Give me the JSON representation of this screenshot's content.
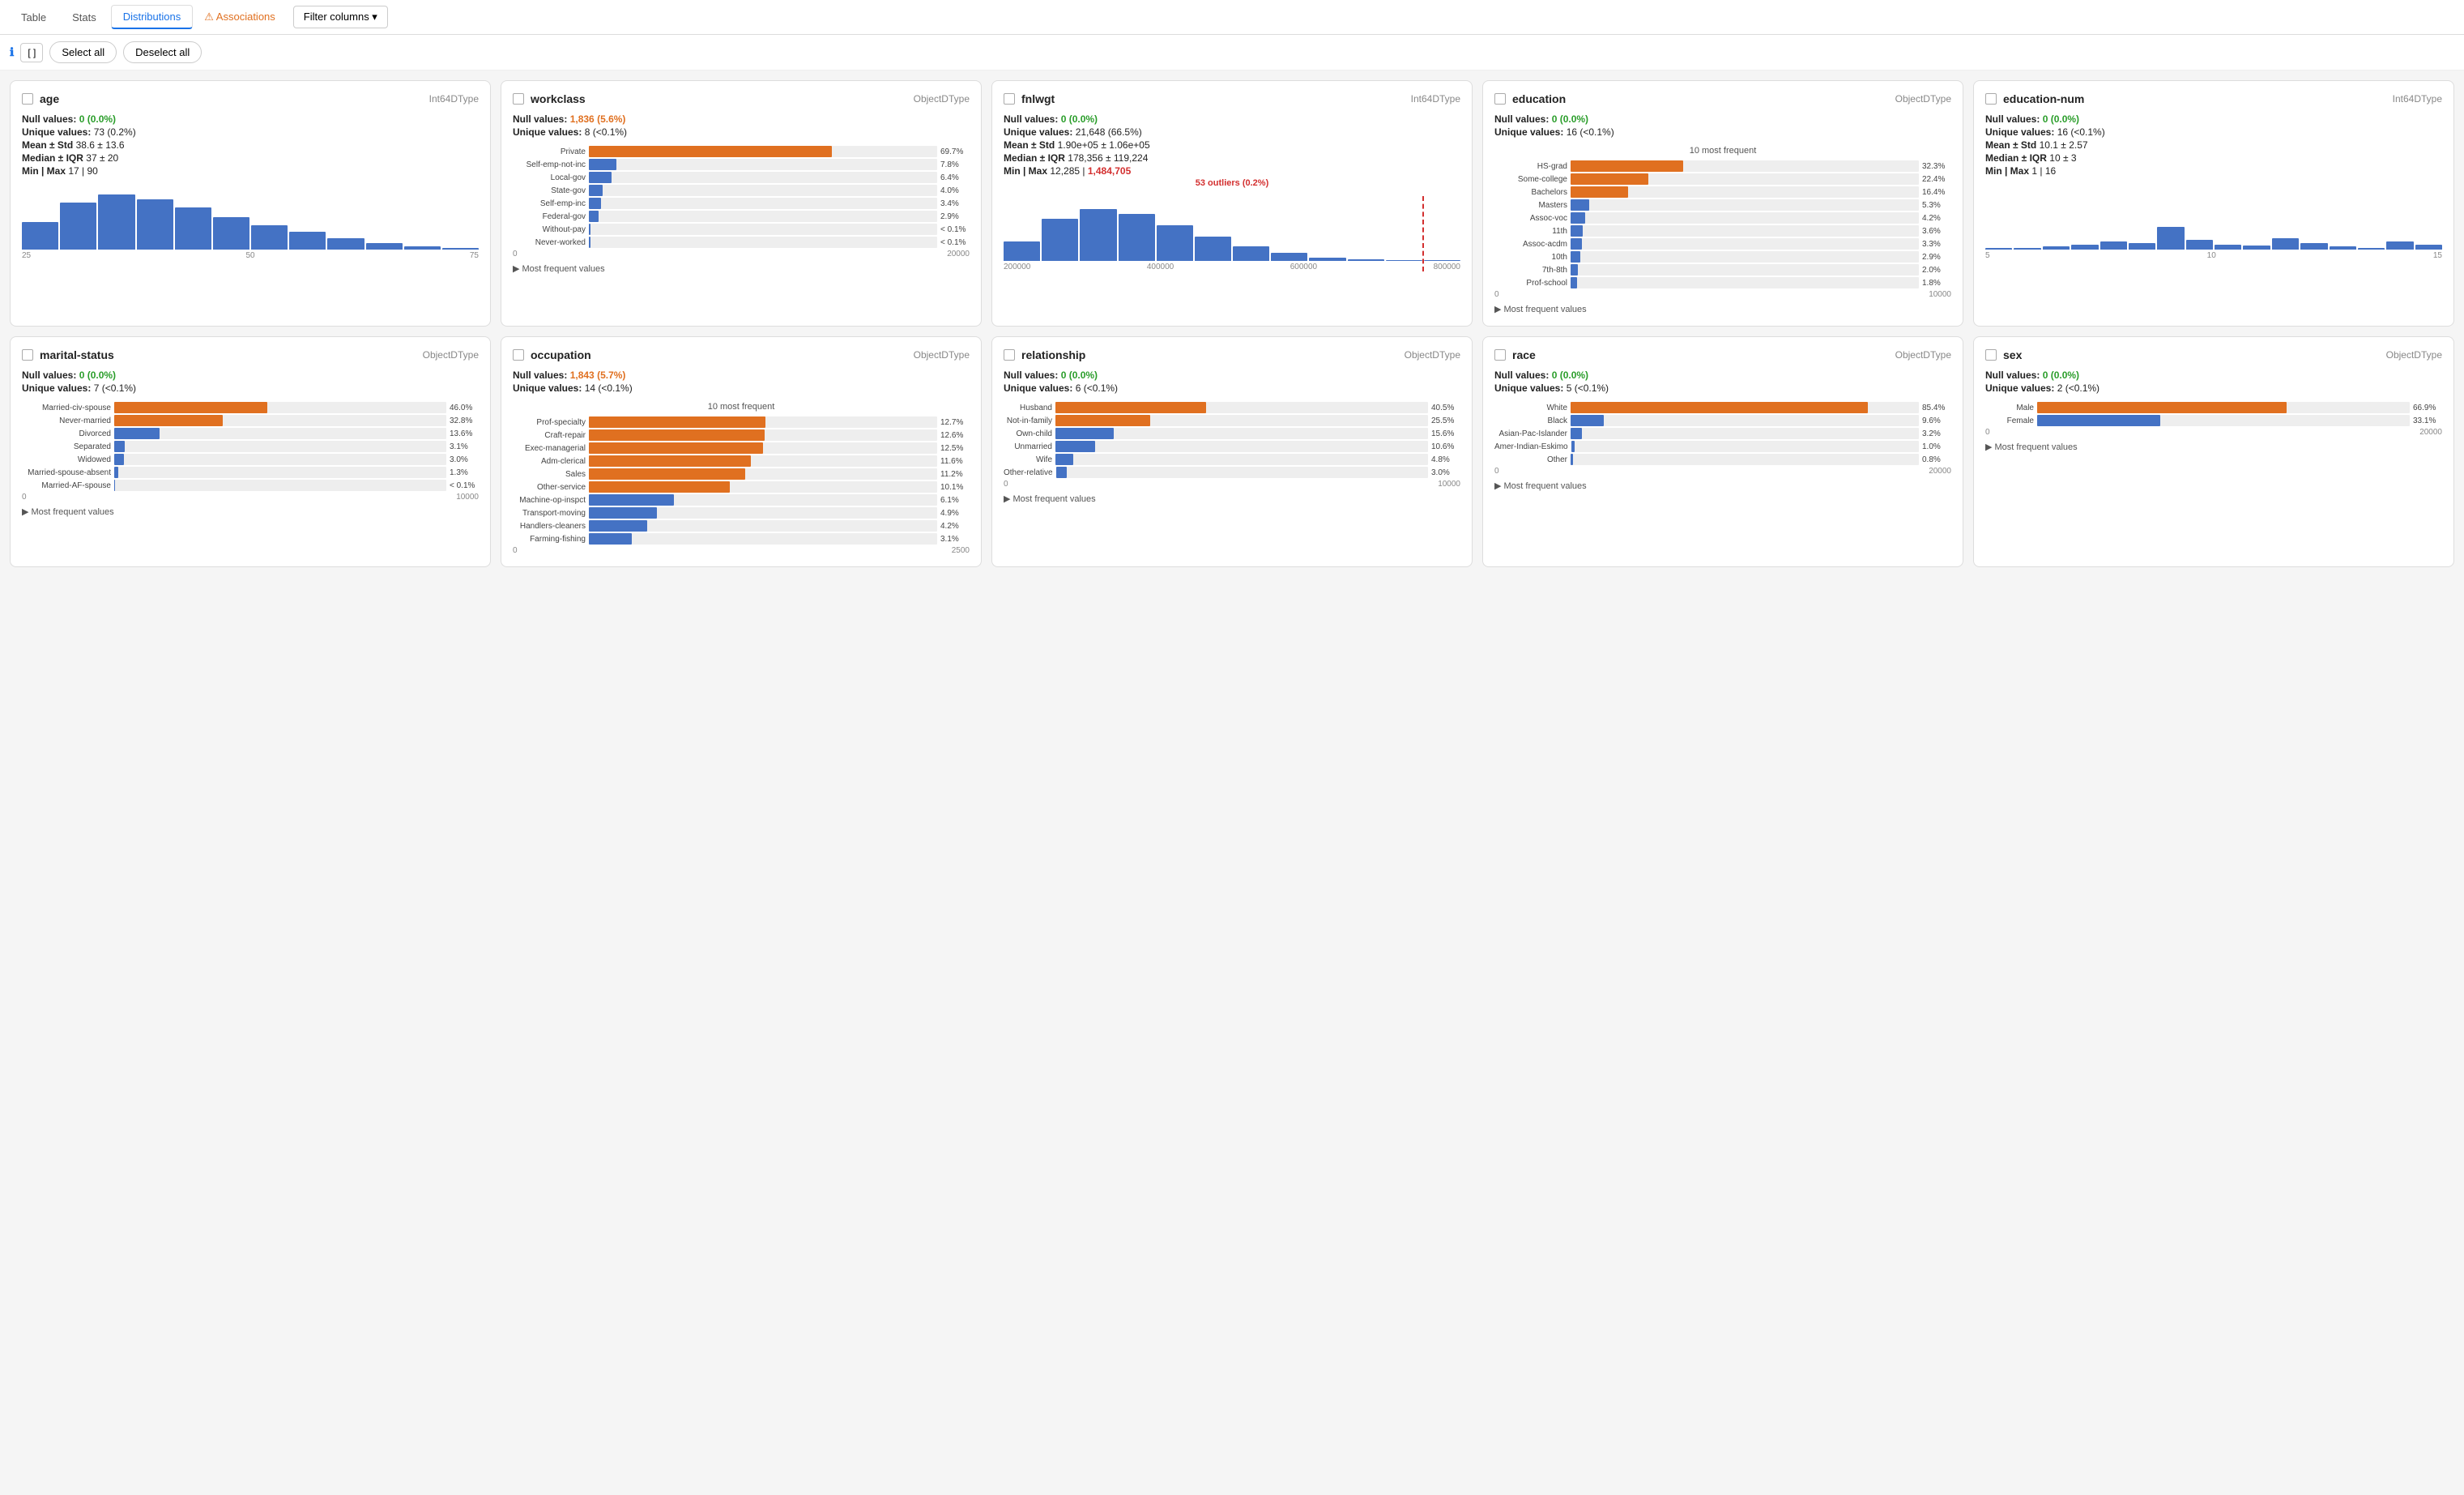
{
  "nav": {
    "tabs": [
      {
        "label": "Table",
        "active": false
      },
      {
        "label": "Stats",
        "active": false
      },
      {
        "label": "Distributions",
        "active": true
      },
      {
        "label": "⚠ Associations",
        "active": false,
        "warning": true
      }
    ],
    "filter_btn": "Filter columns ▾"
  },
  "toolbar": {
    "icon_code": "[ ]",
    "select_all": "Select all",
    "deselect_all": "Deselect all",
    "info_icon": "ℹ"
  },
  "cards": [
    {
      "id": "age",
      "title": "age",
      "type": "Int64DType",
      "null_count": "0",
      "null_pct": "0.0%",
      "null_color": "green",
      "unique": "73",
      "unique_pct": "0.2%",
      "mean_std": "38.6 ± 13.6",
      "median_iqr": "37 ± 20",
      "min_max": "17 | 90",
      "chart_type": "histogram",
      "hist_bars": [
        42,
        72,
        85,
        78,
        65,
        50,
        38,
        28,
        18,
        10,
        5,
        2
      ],
      "hist_max": 5000,
      "hist_axis": [
        "25",
        "50",
        "75"
      ]
    },
    {
      "id": "workclass",
      "title": "workclass",
      "type": "ObjectDType",
      "null_count": "1,836",
      "null_pct": "5.6%",
      "null_color": "orange",
      "unique": "8",
      "unique_pct": "<0.1%",
      "chart_type": "hbar",
      "freq_title": null,
      "bars": [
        {
          "label": "Private",
          "pct": 69.7,
          "orange": true
        },
        {
          "label": "Self-emp-not-inc",
          "pct": 7.8,
          "orange": false
        },
        {
          "label": "Local-gov",
          "pct": 6.4,
          "orange": false
        },
        {
          "label": "State-gov",
          "pct": 4.0,
          "orange": false
        },
        {
          "label": "Self-emp-inc",
          "pct": 3.4,
          "orange": false
        },
        {
          "label": "Federal-gov",
          "pct": 2.9,
          "orange": false
        },
        {
          "label": "Without-pay",
          "pct_text": "< 0.1%",
          "pct": 0.2,
          "orange": false
        },
        {
          "label": "Never-worked",
          "pct_text": "< 0.1%",
          "pct": 0.2,
          "orange": false
        }
      ],
      "axis": [
        "0",
        "20000"
      ],
      "more": "Most frequent values"
    },
    {
      "id": "fnlwgt",
      "title": "fnlwgt",
      "type": "Int64DType",
      "null_count": "0",
      "null_pct": "0.0%",
      "null_color": "green",
      "unique": "21,648",
      "unique_pct": "66.5%",
      "mean_std": "1.90e+05 ± 1.06e+05",
      "median_iqr": "178,356 ± 119,224",
      "min_max_normal": "12,285",
      "min_max_red": "1,484,705",
      "chart_type": "histogram_outlier",
      "hist_bars": [
        30,
        65,
        80,
        72,
        55,
        38,
        22,
        12,
        5,
        2,
        1,
        1
      ],
      "outlier_text": "53 outliers (0.2%)",
      "hist_axis": [
        "200000",
        "400000",
        "600000",
        "800000"
      ]
    },
    {
      "id": "education",
      "title": "education",
      "type": "ObjectDType",
      "null_count": "0",
      "null_pct": "0.0%",
      "null_color": "green",
      "unique": "16",
      "unique_pct": "<0.1%",
      "chart_type": "hbar",
      "freq_title": "10 most frequent",
      "bars": [
        {
          "label": "HS-grad",
          "pct": 32.3,
          "orange": true
        },
        {
          "label": "Some-college",
          "pct": 22.4,
          "orange": true
        },
        {
          "label": "Bachelors",
          "pct": 16.4,
          "orange": true
        },
        {
          "label": "Masters",
          "pct": 5.3,
          "orange": false
        },
        {
          "label": "Assoc-voc",
          "pct": 4.2,
          "orange": false
        },
        {
          "label": "11th",
          "pct": 3.6,
          "orange": false
        },
        {
          "label": "Assoc-acdm",
          "pct": 3.3,
          "orange": false
        },
        {
          "label": "10th",
          "pct": 2.9,
          "orange": false
        },
        {
          "label": "7th-8th",
          "pct": 2.0,
          "orange": false
        },
        {
          "label": "Prof-school",
          "pct": 1.8,
          "orange": false
        }
      ],
      "axis": [
        "0",
        "10000"
      ],
      "more": "Most frequent values"
    },
    {
      "id": "education-num",
      "title": "education-num",
      "type": "Int64DType",
      "null_count": "0",
      "null_pct": "0.0%",
      "null_color": "green",
      "unique": "16",
      "unique_pct": "<0.1%",
      "mean_std": "10.1 ± 2.57",
      "median_iqr": "10 ± 3",
      "min_max": "1 | 16",
      "chart_type": "histogram",
      "hist_bars": [
        2,
        3,
        5,
        8,
        12,
        10,
        35,
        15,
        8,
        6,
        18,
        10,
        5,
        3,
        12,
        8
      ],
      "hist_axis": [
        "5",
        "10",
        "15"
      ]
    }
  ],
  "cards2": [
    {
      "id": "marital-status",
      "title": "marital-status",
      "type": "ObjectDType",
      "null_count": "0",
      "null_pct": "0.0%",
      "null_color": "green",
      "unique": "7",
      "unique_pct": "<0.1%",
      "chart_type": "hbar",
      "freq_title": null,
      "bars": [
        {
          "label": "Married-civ-spouse",
          "pct": 46.0,
          "orange": true
        },
        {
          "label": "Never-married",
          "pct": 32.8,
          "orange": true
        },
        {
          "label": "Divorced",
          "pct": 13.6,
          "orange": false
        },
        {
          "label": "Separated",
          "pct": 3.1,
          "orange": false
        },
        {
          "label": "Widowed",
          "pct": 3.0,
          "orange": false
        },
        {
          "label": "Married-spouse-absent",
          "pct": 1.3,
          "orange": false
        },
        {
          "label": "Married-AF-spouse",
          "pct_text": "< 0.1%",
          "pct": 0.2,
          "orange": false
        }
      ],
      "axis": [
        "0",
        "10000"
      ],
      "more": "Most frequent values"
    },
    {
      "id": "occupation",
      "title": "occupation",
      "type": "ObjectDType",
      "null_count": "1,843",
      "null_pct": "5.7%",
      "null_color": "orange",
      "unique": "14",
      "unique_pct": "<0.1%",
      "chart_type": "hbar",
      "freq_title": "10 most frequent",
      "bars": [
        {
          "label": "Prof-specialty",
          "pct": 12.7,
          "orange": true
        },
        {
          "label": "Craft-repair",
          "pct": 12.6,
          "orange": true
        },
        {
          "label": "Exec-managerial",
          "pct": 12.5,
          "orange": true
        },
        {
          "label": "Adm-clerical",
          "pct": 11.6,
          "orange": true
        },
        {
          "label": "Sales",
          "pct": 11.2,
          "orange": true
        },
        {
          "label": "Other-service",
          "pct": 10.1,
          "orange": true
        },
        {
          "label": "Machine-op-inspct",
          "pct": 6.1,
          "orange": false
        },
        {
          "label": "Transport-moving",
          "pct": 4.9,
          "orange": false
        },
        {
          "label": "Handlers-cleaners",
          "pct": 4.2,
          "orange": false
        },
        {
          "label": "Farming-fishing",
          "pct": 3.1,
          "orange": false
        }
      ],
      "axis": [
        "0",
        "2500"
      ],
      "more": null
    },
    {
      "id": "relationship",
      "title": "relationship",
      "type": "ObjectDType",
      "null_count": "0",
      "null_pct": "0.0%",
      "null_color": "green",
      "unique": "6",
      "unique_pct": "<0.1%",
      "chart_type": "hbar",
      "freq_title": null,
      "bars": [
        {
          "label": "Husband",
          "pct": 40.5,
          "orange": true
        },
        {
          "label": "Not-in-family",
          "pct": 25.5,
          "orange": true
        },
        {
          "label": "Own-child",
          "pct": 15.6,
          "orange": false
        },
        {
          "label": "Unmarried",
          "pct": 10.6,
          "orange": false
        },
        {
          "label": "Wife",
          "pct": 4.8,
          "orange": false
        },
        {
          "label": "Other-relative",
          "pct": 3.0,
          "orange": false
        }
      ],
      "axis": [
        "0",
        "10000"
      ],
      "more": "Most frequent values"
    },
    {
      "id": "race",
      "title": "race",
      "type": "ObjectDType",
      "null_count": "0",
      "null_pct": "0.0%",
      "null_color": "green",
      "unique": "5",
      "unique_pct": "<0.1%",
      "chart_type": "hbar",
      "freq_title": null,
      "bars": [
        {
          "label": "White",
          "pct": 85.4,
          "orange": true
        },
        {
          "label": "Black",
          "pct": 9.6,
          "orange": false
        },
        {
          "label": "Asian-Pac-Islander",
          "pct": 3.2,
          "orange": false
        },
        {
          "label": "Amer-Indian-Eskimo",
          "pct": 1.0,
          "orange": false
        },
        {
          "label": "Other",
          "pct": 0.8,
          "orange": false
        }
      ],
      "axis": [
        "0",
        "20000"
      ],
      "more": "Most frequent values"
    },
    {
      "id": "sex",
      "title": "sex",
      "type": "ObjectDType",
      "null_count": "0",
      "null_pct": "0.0%",
      "null_color": "green",
      "unique": "2",
      "unique_pct": "<0.1%",
      "chart_type": "hbar",
      "freq_title": null,
      "bars": [
        {
          "label": "Male",
          "pct": 66.9,
          "orange": true
        },
        {
          "label": "Female",
          "pct": 33.1,
          "orange": false
        }
      ],
      "axis": [
        "0",
        "20000"
      ],
      "more": "Most frequent values"
    }
  ]
}
